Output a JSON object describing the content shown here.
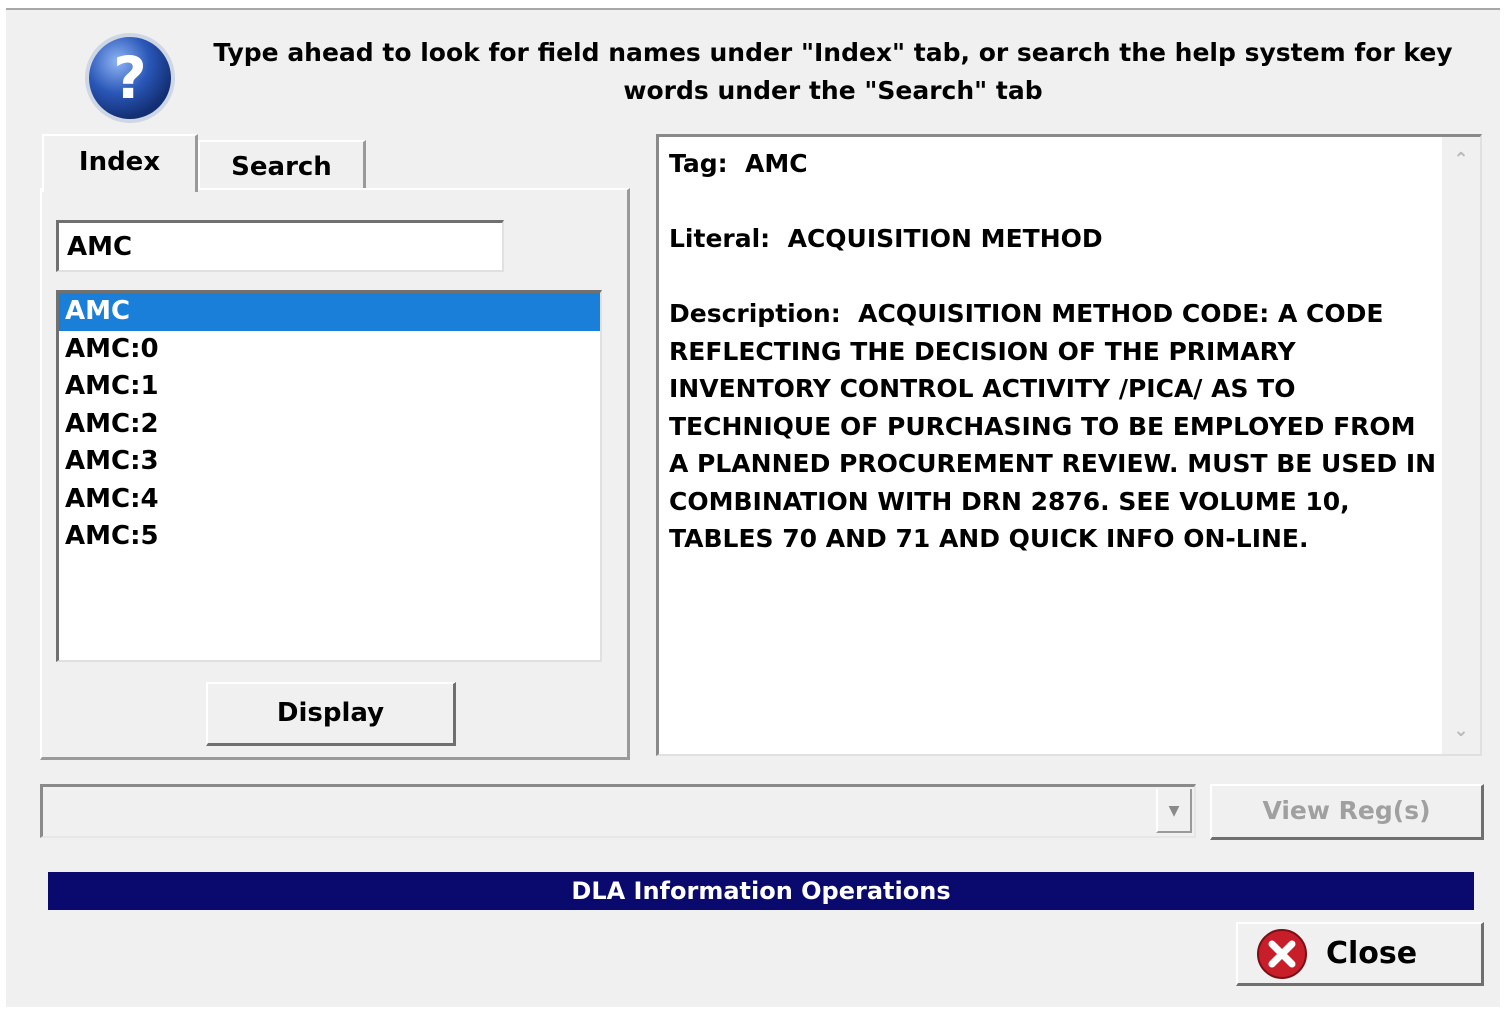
{
  "instruction": {
    "text": "Type ahead to look for field names under \"Index\" tab, or search the help system for key words under the \"Search\" tab"
  },
  "tabs": [
    {
      "label": "Index",
      "active": true
    },
    {
      "label": "Search",
      "active": false
    }
  ],
  "index_panel": {
    "search_value": "AMC",
    "items": [
      "AMC",
      "AMC:0",
      "AMC:1",
      "AMC:2",
      "AMC:3",
      "AMC:4",
      "AMC:5"
    ],
    "selected_item": "AMC",
    "display_label": "Display"
  },
  "detail": {
    "tag_label": "Tag:",
    "tag_value": "AMC",
    "literal_label": "Literal:",
    "literal_value": "ACQUISITION METHOD",
    "description_label": "Description:",
    "description_value": "ACQUISITION METHOD CODE: A CODE REFLECTING THE DECISION OF THE PRIMARY INVENTORY CONTROL ACTIVITY /PICA/ AS TO TECHNIQUE OF PURCHASING TO BE EMPLOYED FROM A PLANNED PROCUREMENT REVIEW. MUST BE USED IN COMBINATION WITH DRN 2876. SEE VOLUME 10, TABLES 70 AND 71 AND QUICK INFO ON-LINE."
  },
  "regs": {
    "selected_value": "",
    "view_label": "View Reg(s)",
    "view_enabled": false
  },
  "footer": {
    "banner": "DLA Information Operations",
    "close_label": "Close"
  },
  "colors": {
    "dialog_bg": "#f0f0f0",
    "selection": "#1a7fd8",
    "banner_bg": "#0a0a6e",
    "help_icon": "#2a57b8",
    "close_icon": "#c81e2a"
  },
  "icons": {
    "help": "question-mark-circle",
    "close": "red-x-circle",
    "combo": "chevron-down",
    "scroll_up": "chevron-up",
    "scroll_down": "chevron-down"
  }
}
